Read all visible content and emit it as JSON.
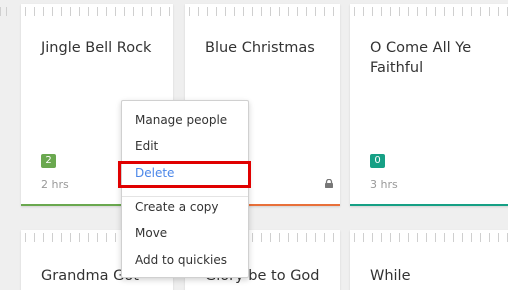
{
  "cards": [
    {
      "title": "Jingle Bell Rock",
      "badge": "2",
      "badge_color": "#6aa84f",
      "meta": "2 hrs",
      "bar_color": "#6aa84f"
    },
    {
      "title": "Blue Christmas",
      "bar_color": "#e8703a",
      "lock_icon": "lock-icon"
    },
    {
      "title": "O Come All Ye Faithful",
      "badge": "0",
      "badge_color": "#16a085",
      "meta": "3 hrs",
      "bar_color": "#16a085"
    },
    {
      "title": "Grandma Got"
    },
    {
      "title": "Glory be to God"
    },
    {
      "title": "While"
    }
  ],
  "context_menu": {
    "items": [
      "Manage people",
      "Edit",
      "Delete",
      "Create a copy",
      "Move",
      "Add to quickies"
    ],
    "highlighted": "Delete",
    "highlight_color": "#e00000",
    "delete_color": "#4a86e8"
  }
}
